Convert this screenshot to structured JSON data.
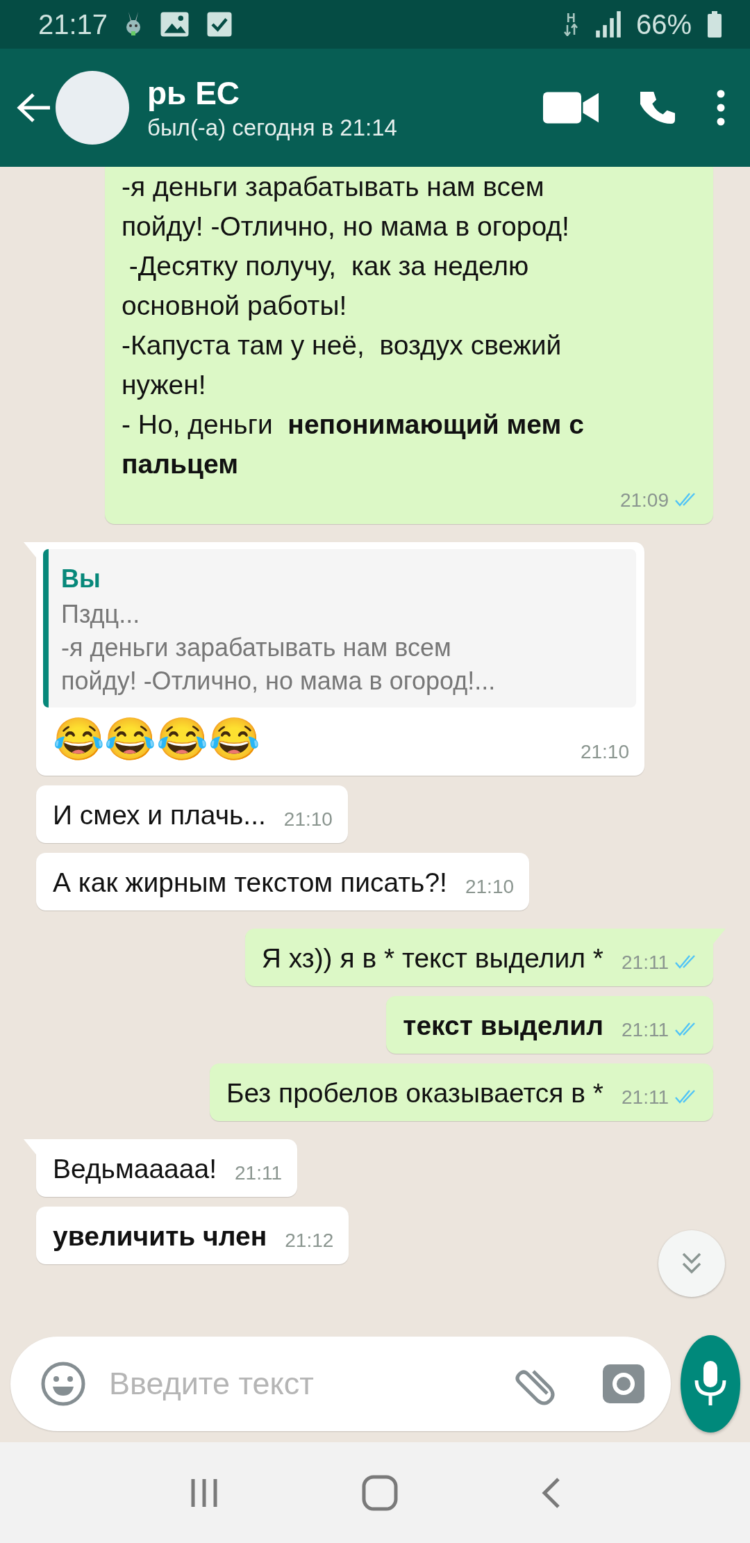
{
  "status_bar": {
    "time": "21:17",
    "network_type": "H",
    "battery": "66%"
  },
  "header": {
    "name": "рь ЕС",
    "last_seen": "был(-а) сегодня в 21:14"
  },
  "messages": [
    {
      "outgoing": true,
      "tail": false,
      "text": "-я деньги зарабатывать нам всем\nпойду! -Отлично, но мама в огород!\n -Десятку получу,  как за неделю\nосновной работы!\n-Капуста там у неё,  воздух свежий\nнужен!\n- Но, деньги  **непонимающий мем с пальцем**",
      "time": "21:09",
      "read": true
    },
    {
      "outgoing": false,
      "tail": true,
      "quote": {
        "author": "Вы",
        "text": "Пздц...\n-я деньги зарабатывать нам всем\nпойду! -Отлично, но мама в огород!..."
      },
      "emoji": "😂😂😂😂",
      "time": "21:10"
    },
    {
      "outgoing": false,
      "tail": false,
      "text": "И смех и плачь...",
      "time": "21:10"
    },
    {
      "outgoing": false,
      "tail": false,
      "text": "А как жирным текстом писать?!",
      "time": "21:10"
    },
    {
      "outgoing": true,
      "tail": true,
      "text": "Я хз)) я в * текст выделил *",
      "time": "21:11",
      "read": true
    },
    {
      "outgoing": true,
      "tail": false,
      "bold": true,
      "text": "текст выделил",
      "time": "21:11",
      "read": true
    },
    {
      "outgoing": true,
      "tail": false,
      "text": "Без пробелов оказывается в *",
      "time": "21:11",
      "read": true
    },
    {
      "outgoing": false,
      "tail": true,
      "text": "Ведьмааааа!",
      "time": "21:11"
    },
    {
      "outgoing": false,
      "tail": false,
      "bold": true,
      "text": "увеличить член",
      "time": "21:12"
    }
  ],
  "composer": {
    "placeholder": "Введите текст"
  }
}
